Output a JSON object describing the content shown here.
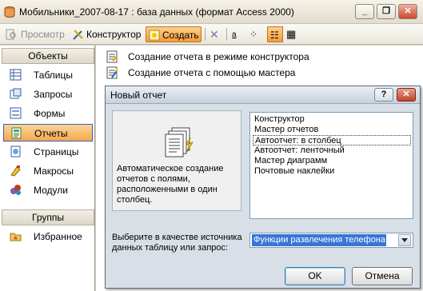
{
  "window": {
    "title": "Мобильники_2007-08-17 : база данных (формат Access 2000)"
  },
  "toolbar": {
    "preview_label": "Просмотр",
    "designer_label": "Конструктор",
    "create_label": "Создать"
  },
  "nav": {
    "objects_header": "Объекты",
    "items": [
      {
        "label": "Таблицы",
        "icon": "table-icon"
      },
      {
        "label": "Запросы",
        "icon": "query-icon"
      },
      {
        "label": "Формы",
        "icon": "form-icon"
      },
      {
        "label": "Отчеты",
        "icon": "report-icon",
        "active": true
      },
      {
        "label": "Страницы",
        "icon": "page-icon"
      },
      {
        "label": "Макросы",
        "icon": "macro-icon"
      },
      {
        "label": "Модули",
        "icon": "module-icon"
      }
    ],
    "groups_header": "Группы",
    "favorites_label": "Избранное"
  },
  "main": {
    "items": [
      "Создание отчета в режиме конструктора",
      "Создание отчета с помощью мастера"
    ]
  },
  "dialog": {
    "title": "Новый отчет",
    "description": "Автоматическое создание отчетов с полями, расположенными в один столбец.",
    "list": [
      "Конструктор",
      "Мастер отчетов",
      "Автоотчет: в столбец",
      "Автоотчет: ленточный",
      "Мастер диаграмм",
      "Почтовые наклейки"
    ],
    "selected_index": 2,
    "prompt": "Выберите в качестве источника данных таблицу или запрос:",
    "combo_value": "Функции развлечения телефона",
    "ok_label": "OK",
    "cancel_label": "Отмена"
  },
  "colors": {
    "active_nav": "#f4a94f",
    "selection": "#3875d6",
    "dialog_bg": "#d8dfe7"
  }
}
